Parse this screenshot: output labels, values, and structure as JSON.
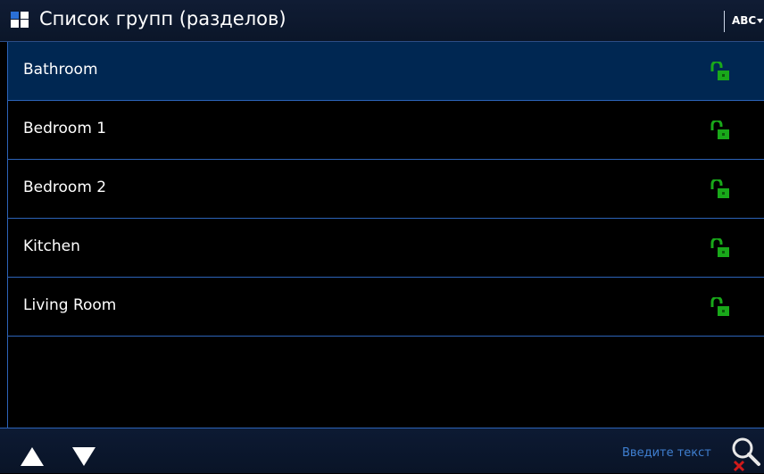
{
  "header": {
    "title": "Список групп (разделов)",
    "app_icon": "partitions-grid-icon",
    "keyboard_mode_label": "ABC"
  },
  "list": {
    "items": [
      {
        "label": "Bathroom",
        "selected": true,
        "status_icon": "unlocked-padlock-icon"
      },
      {
        "label": "Bedroom 1",
        "selected": false,
        "status_icon": "unlocked-padlock-icon"
      },
      {
        "label": "Bedroom 2",
        "selected": false,
        "status_icon": "unlocked-padlock-icon"
      },
      {
        "label": "Kitchen",
        "selected": false,
        "status_icon": "unlocked-padlock-icon"
      },
      {
        "label": "Living Room",
        "selected": false,
        "status_icon": "unlocked-padlock-icon"
      }
    ]
  },
  "footer": {
    "search_placeholder": "Введите текст",
    "up_icon": "arrow-up-icon",
    "down_icon": "arrow-down-icon",
    "search_icon": "search-clear-icon"
  },
  "colors": {
    "accent": "#2c63b8",
    "selected_row": "#002752",
    "unlocked": "#19a81a",
    "hint_text": "#3f7fd0",
    "clear_mark": "#d01a1a"
  }
}
